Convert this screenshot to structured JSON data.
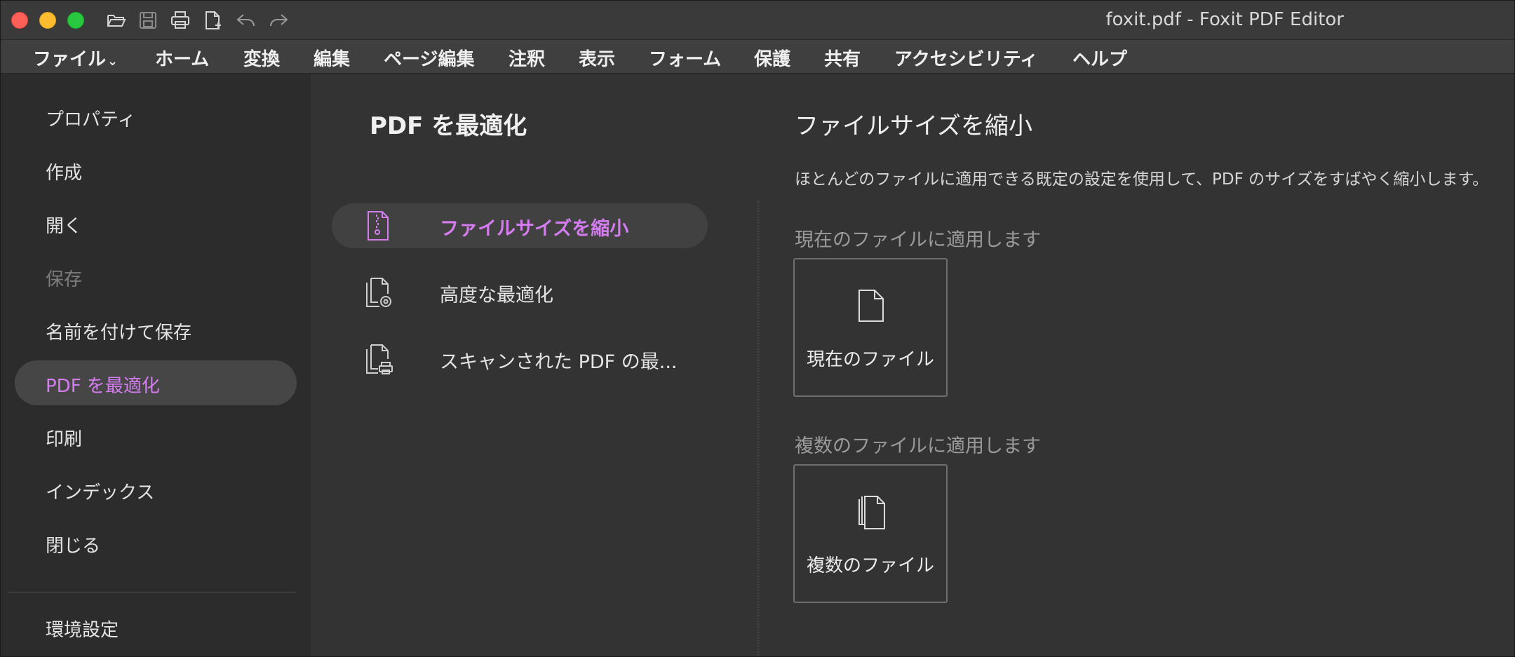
{
  "window": {
    "title": "foxit.pdf - Foxit PDF Editor"
  },
  "toolbar": {
    "icons": [
      "open-folder-icon",
      "save-icon",
      "print-icon",
      "new-document-icon",
      "undo-icon",
      "redo-icon"
    ]
  },
  "menu": {
    "items": [
      "ファイル",
      "ホーム",
      "変換",
      "編集",
      "ページ編集",
      "注釈",
      "表示",
      "フォーム",
      "保護",
      "共有",
      "アクセシビリティ",
      "ヘルプ"
    ]
  },
  "sidebar": {
    "items": [
      {
        "label": "プロパティ",
        "state": "normal"
      },
      {
        "label": "作成",
        "state": "normal"
      },
      {
        "label": "開く",
        "state": "normal"
      },
      {
        "label": "保存",
        "state": "disabled"
      },
      {
        "label": "名前を付けて保存",
        "state": "normal"
      },
      {
        "label": "PDF を最適化",
        "state": "active"
      },
      {
        "label": "印刷",
        "state": "normal"
      },
      {
        "label": "インデックス",
        "state": "normal"
      },
      {
        "label": "閉じる",
        "state": "normal"
      }
    ],
    "footer_item": "環境設定"
  },
  "optimize": {
    "title": "PDF を最適化",
    "options": [
      {
        "label": "ファイルサイズを縮小",
        "icon": "zip-file-icon",
        "active": true
      },
      {
        "label": "高度な最適化",
        "icon": "files-gear-icon",
        "active": false
      },
      {
        "label": "スキャンされた PDF の最...",
        "icon": "files-scanner-icon",
        "active": false
      }
    ]
  },
  "content": {
    "title": "ファイルサイズを縮小",
    "description": "ほとんどのファイルに適用できる既定の設定を使用して、PDF のサイズをすばやく縮小します。",
    "current_section_label": "現在のファイルに適用します",
    "current_card_label": "現在のファイル",
    "multiple_section_label": "複数のファイルに適用します",
    "multiple_card_label": "複数のファイル"
  },
  "colors": {
    "accent": "#d47cf0",
    "background": "#2b2b2b",
    "panel": "#333333"
  }
}
